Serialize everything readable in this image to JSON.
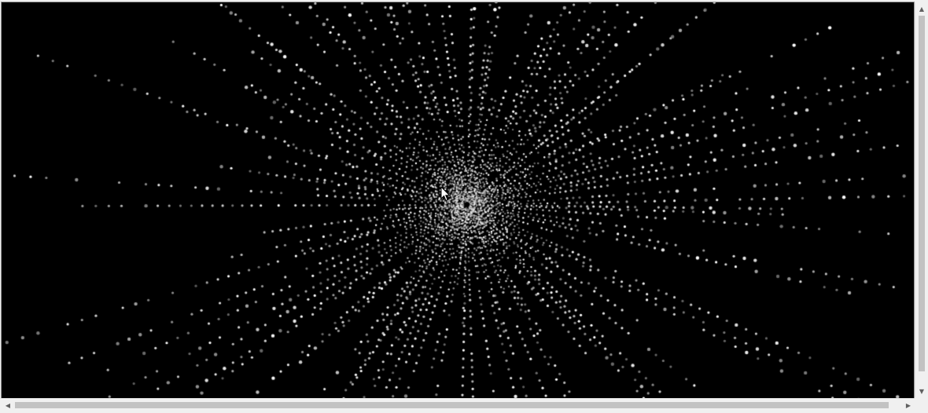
{
  "scene": {
    "background": "#000000",
    "star_color": "#ffffff",
    "pointer": "mouse-cursor-icon"
  },
  "scrollbars": {
    "vertical": {
      "up_icon": "arrow-up-icon",
      "down_icon": "arrow-down-icon",
      "up_glyph": "▲",
      "down_glyph": "▼"
    },
    "horizontal": {
      "left_icon": "arrow-left-icon",
      "right_icon": "arrow-right-icon",
      "left_glyph": "◀",
      "right_glyph": "▶"
    },
    "track_color": "#f0f0f0",
    "thumb_color": "#c2c2c2"
  }
}
